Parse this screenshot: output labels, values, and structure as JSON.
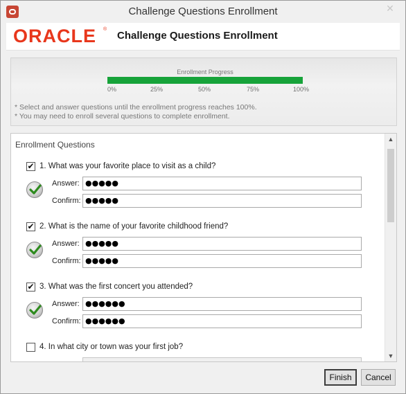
{
  "window": {
    "title": "Challenge Questions Enrollment",
    "close_glyph": "✕"
  },
  "header": {
    "logo_text": "ORACLE",
    "logo_mark": "®",
    "title": "Challenge Questions Enrollment",
    "brand_color": "#e8371c"
  },
  "progress": {
    "label": "Enrollment Progress",
    "value_fraction": 1.0,
    "fill_color": "#17a33a",
    "ticks": [
      "0%",
      "25%",
      "50%",
      "75%",
      "100%"
    ],
    "hints": [
      "* Select and answer questions until the enrollment progress reaches 100%.",
      "* You may need to enroll several questions to complete enrollment."
    ]
  },
  "questions_panel": {
    "heading": "Enrollment Questions",
    "answer_label": "Answer:",
    "confirm_label": "Confirm:",
    "items": [
      {
        "checked": true,
        "text": "1. What was your favorite place to visit as a child?",
        "answer": "●●●●●",
        "confirm": "●●●●●",
        "status_icon": "checkmark-icon"
      },
      {
        "checked": true,
        "text": "2. What is the name of your favorite childhood friend?",
        "answer": "●●●●●",
        "confirm": "●●●●●",
        "status_icon": "checkmark-icon"
      },
      {
        "checked": true,
        "text": "3. What was the first concert you attended?",
        "answer": "●●●●●●",
        "confirm": "●●●●●●",
        "status_icon": "checkmark-icon"
      },
      {
        "checked": false,
        "text": "4. In what city or town was your first job?",
        "answer": "",
        "confirm": "",
        "status_icon": ""
      }
    ],
    "scroll_up_glyph": "▲",
    "scroll_down_glyph": "▼"
  },
  "buttons": {
    "finish": "Finish",
    "cancel": "Cancel"
  }
}
